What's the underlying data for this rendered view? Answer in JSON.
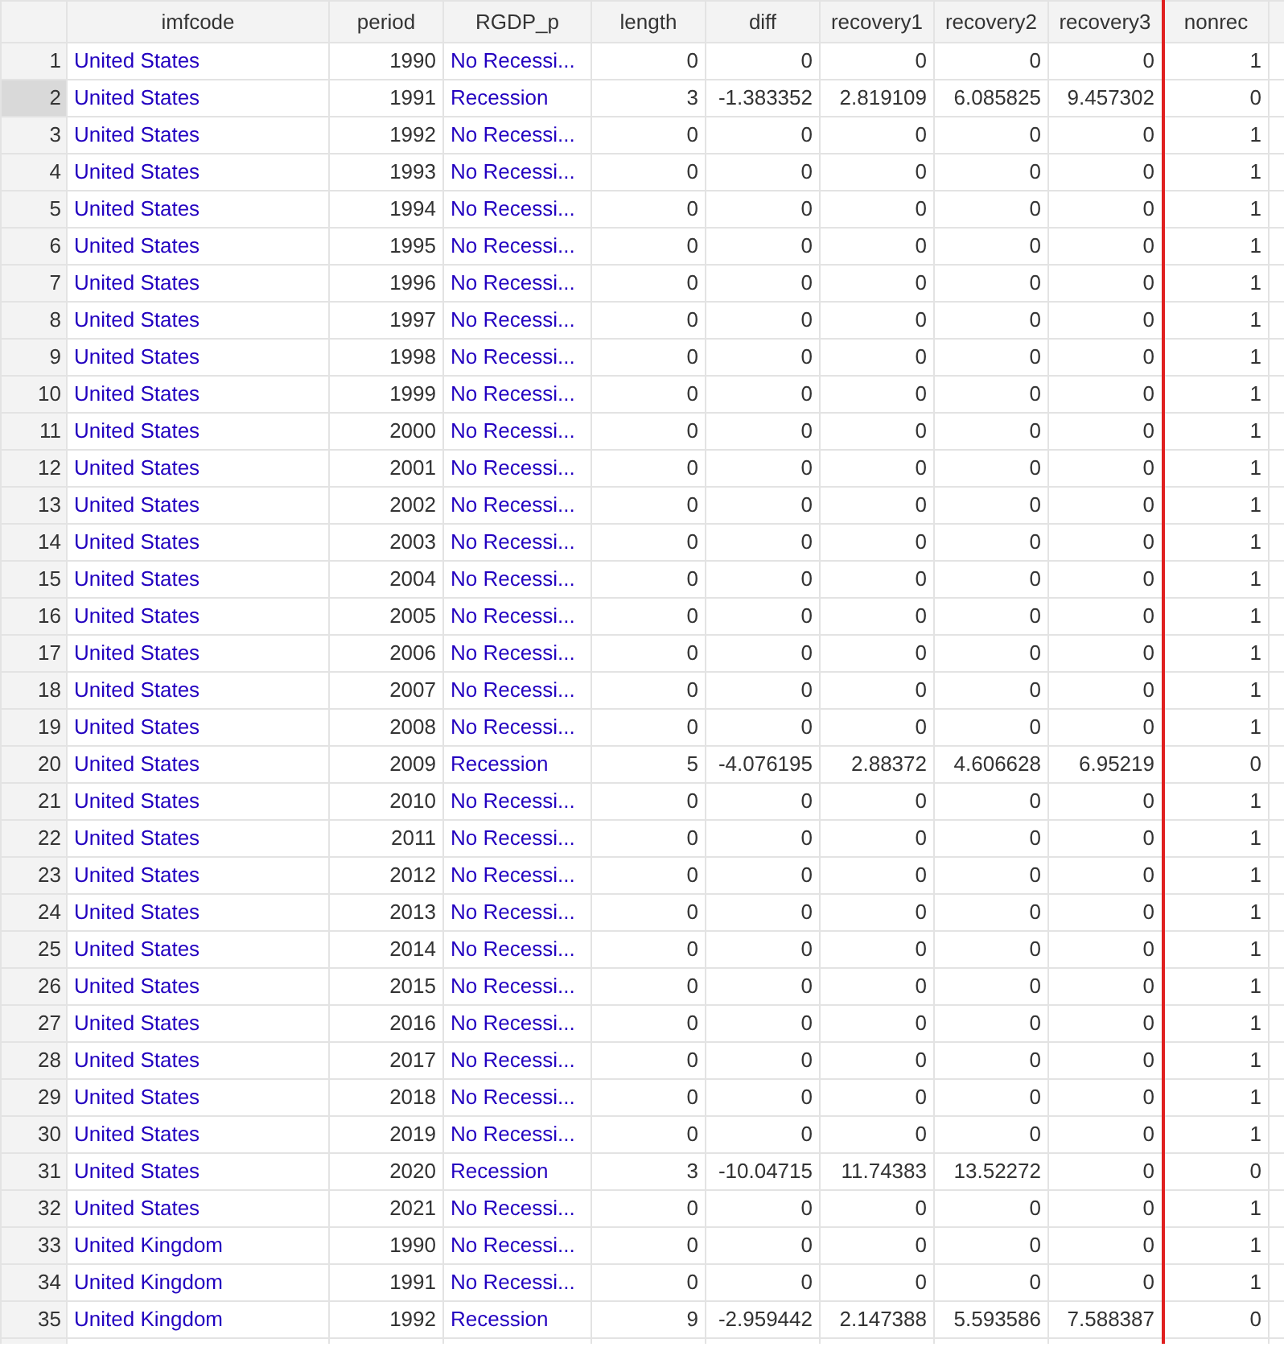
{
  "table": {
    "columns": [
      "imfcode",
      "period",
      "RGDP_p",
      "length",
      "diff",
      "recovery1",
      "recovery2",
      "recovery3",
      "nonrec"
    ],
    "rows": [
      {
        "number": "1",
        "selected": false,
        "cells": [
          "United States",
          "1990",
          "No Recessi...",
          "0",
          "0",
          "0",
          "0",
          "0",
          "1"
        ]
      },
      {
        "number": "2",
        "selected": true,
        "cells": [
          "United States",
          "1991",
          "Recession",
          "3",
          "-1.383352",
          "2.819109",
          "6.085825",
          "9.457302",
          "0"
        ]
      },
      {
        "number": "3",
        "selected": false,
        "cells": [
          "United States",
          "1992",
          "No Recessi...",
          "0",
          "0",
          "0",
          "0",
          "0",
          "1"
        ]
      },
      {
        "number": "4",
        "selected": false,
        "cells": [
          "United States",
          "1993",
          "No Recessi...",
          "0",
          "0",
          "0",
          "0",
          "0",
          "1"
        ]
      },
      {
        "number": "5",
        "selected": false,
        "cells": [
          "United States",
          "1994",
          "No Recessi...",
          "0",
          "0",
          "0",
          "0",
          "0",
          "1"
        ]
      },
      {
        "number": "6",
        "selected": false,
        "cells": [
          "United States",
          "1995",
          "No Recessi...",
          "0",
          "0",
          "0",
          "0",
          "0",
          "1"
        ]
      },
      {
        "number": "7",
        "selected": false,
        "cells": [
          "United States",
          "1996",
          "No Recessi...",
          "0",
          "0",
          "0",
          "0",
          "0",
          "1"
        ]
      },
      {
        "number": "8",
        "selected": false,
        "cells": [
          "United States",
          "1997",
          "No Recessi...",
          "0",
          "0",
          "0",
          "0",
          "0",
          "1"
        ]
      },
      {
        "number": "9",
        "selected": false,
        "cells": [
          "United States",
          "1998",
          "No Recessi...",
          "0",
          "0",
          "0",
          "0",
          "0",
          "1"
        ]
      },
      {
        "number": "10",
        "selected": false,
        "cells": [
          "United States",
          "1999",
          "No Recessi...",
          "0",
          "0",
          "0",
          "0",
          "0",
          "1"
        ]
      },
      {
        "number": "11",
        "selected": false,
        "cells": [
          "United States",
          "2000",
          "No Recessi...",
          "0",
          "0",
          "0",
          "0",
          "0",
          "1"
        ]
      },
      {
        "number": "12",
        "selected": false,
        "cells": [
          "United States",
          "2001",
          "No Recessi...",
          "0",
          "0",
          "0",
          "0",
          "0",
          "1"
        ]
      },
      {
        "number": "13",
        "selected": false,
        "cells": [
          "United States",
          "2002",
          "No Recessi...",
          "0",
          "0",
          "0",
          "0",
          "0",
          "1"
        ]
      },
      {
        "number": "14",
        "selected": false,
        "cells": [
          "United States",
          "2003",
          "No Recessi...",
          "0",
          "0",
          "0",
          "0",
          "0",
          "1"
        ]
      },
      {
        "number": "15",
        "selected": false,
        "cells": [
          "United States",
          "2004",
          "No Recessi...",
          "0",
          "0",
          "0",
          "0",
          "0",
          "1"
        ]
      },
      {
        "number": "16",
        "selected": false,
        "cells": [
          "United States",
          "2005",
          "No Recessi...",
          "0",
          "0",
          "0",
          "0",
          "0",
          "1"
        ]
      },
      {
        "number": "17",
        "selected": false,
        "cells": [
          "United States",
          "2006",
          "No Recessi...",
          "0",
          "0",
          "0",
          "0",
          "0",
          "1"
        ]
      },
      {
        "number": "18",
        "selected": false,
        "cells": [
          "United States",
          "2007",
          "No Recessi...",
          "0",
          "0",
          "0",
          "0",
          "0",
          "1"
        ]
      },
      {
        "number": "19",
        "selected": false,
        "cells": [
          "United States",
          "2008",
          "No Recessi...",
          "0",
          "0",
          "0",
          "0",
          "0",
          "1"
        ]
      },
      {
        "number": "20",
        "selected": false,
        "cells": [
          "United States",
          "2009",
          "Recession",
          "5",
          "-4.076195",
          "2.88372",
          "4.606628",
          "6.95219",
          "0"
        ]
      },
      {
        "number": "21",
        "selected": false,
        "cells": [
          "United States",
          "2010",
          "No Recessi...",
          "0",
          "0",
          "0",
          "0",
          "0",
          "1"
        ]
      },
      {
        "number": "22",
        "selected": false,
        "cells": [
          "United States",
          "2011",
          "No Recessi...",
          "0",
          "0",
          "0",
          "0",
          "0",
          "1"
        ]
      },
      {
        "number": "23",
        "selected": false,
        "cells": [
          "United States",
          "2012",
          "No Recessi...",
          "0",
          "0",
          "0",
          "0",
          "0",
          "1"
        ]
      },
      {
        "number": "24",
        "selected": false,
        "cells": [
          "United States",
          "2013",
          "No Recessi...",
          "0",
          "0",
          "0",
          "0",
          "0",
          "1"
        ]
      },
      {
        "number": "25",
        "selected": false,
        "cells": [
          "United States",
          "2014",
          "No Recessi...",
          "0",
          "0",
          "0",
          "0",
          "0",
          "1"
        ]
      },
      {
        "number": "26",
        "selected": false,
        "cells": [
          "United States",
          "2015",
          "No Recessi...",
          "0",
          "0",
          "0",
          "0",
          "0",
          "1"
        ]
      },
      {
        "number": "27",
        "selected": false,
        "cells": [
          "United States",
          "2016",
          "No Recessi...",
          "0",
          "0",
          "0",
          "0",
          "0",
          "1"
        ]
      },
      {
        "number": "28",
        "selected": false,
        "cells": [
          "United States",
          "2017",
          "No Recessi...",
          "0",
          "0",
          "0",
          "0",
          "0",
          "1"
        ]
      },
      {
        "number": "29",
        "selected": false,
        "cells": [
          "United States",
          "2018",
          "No Recessi...",
          "0",
          "0",
          "0",
          "0",
          "0",
          "1"
        ]
      },
      {
        "number": "30",
        "selected": false,
        "cells": [
          "United States",
          "2019",
          "No Recessi...",
          "0",
          "0",
          "0",
          "0",
          "0",
          "1"
        ]
      },
      {
        "number": "31",
        "selected": false,
        "cells": [
          "United States",
          "2020",
          "Recession",
          "3",
          "-10.04715",
          "11.74383",
          "13.52272",
          "0",
          "0"
        ]
      },
      {
        "number": "32",
        "selected": false,
        "cells": [
          "United States",
          "2021",
          "No Recessi...",
          "0",
          "0",
          "0",
          "0",
          "0",
          "1"
        ]
      },
      {
        "number": "33",
        "selected": false,
        "cells": [
          "United Kingdom",
          "1990",
          "No Recessi...",
          "0",
          "0",
          "0",
          "0",
          "0",
          "1"
        ]
      },
      {
        "number": "34",
        "selected": false,
        "cells": [
          "United Kingdom",
          "1991",
          "No Recessi...",
          "0",
          "0",
          "0",
          "0",
          "0",
          "1"
        ]
      },
      {
        "number": "35",
        "selected": false,
        "cells": [
          "United Kingdom",
          "1992",
          "Recession",
          "9",
          "-2.959442",
          "2.147388",
          "5.593586",
          "7.588387",
          "0"
        ]
      }
    ]
  }
}
